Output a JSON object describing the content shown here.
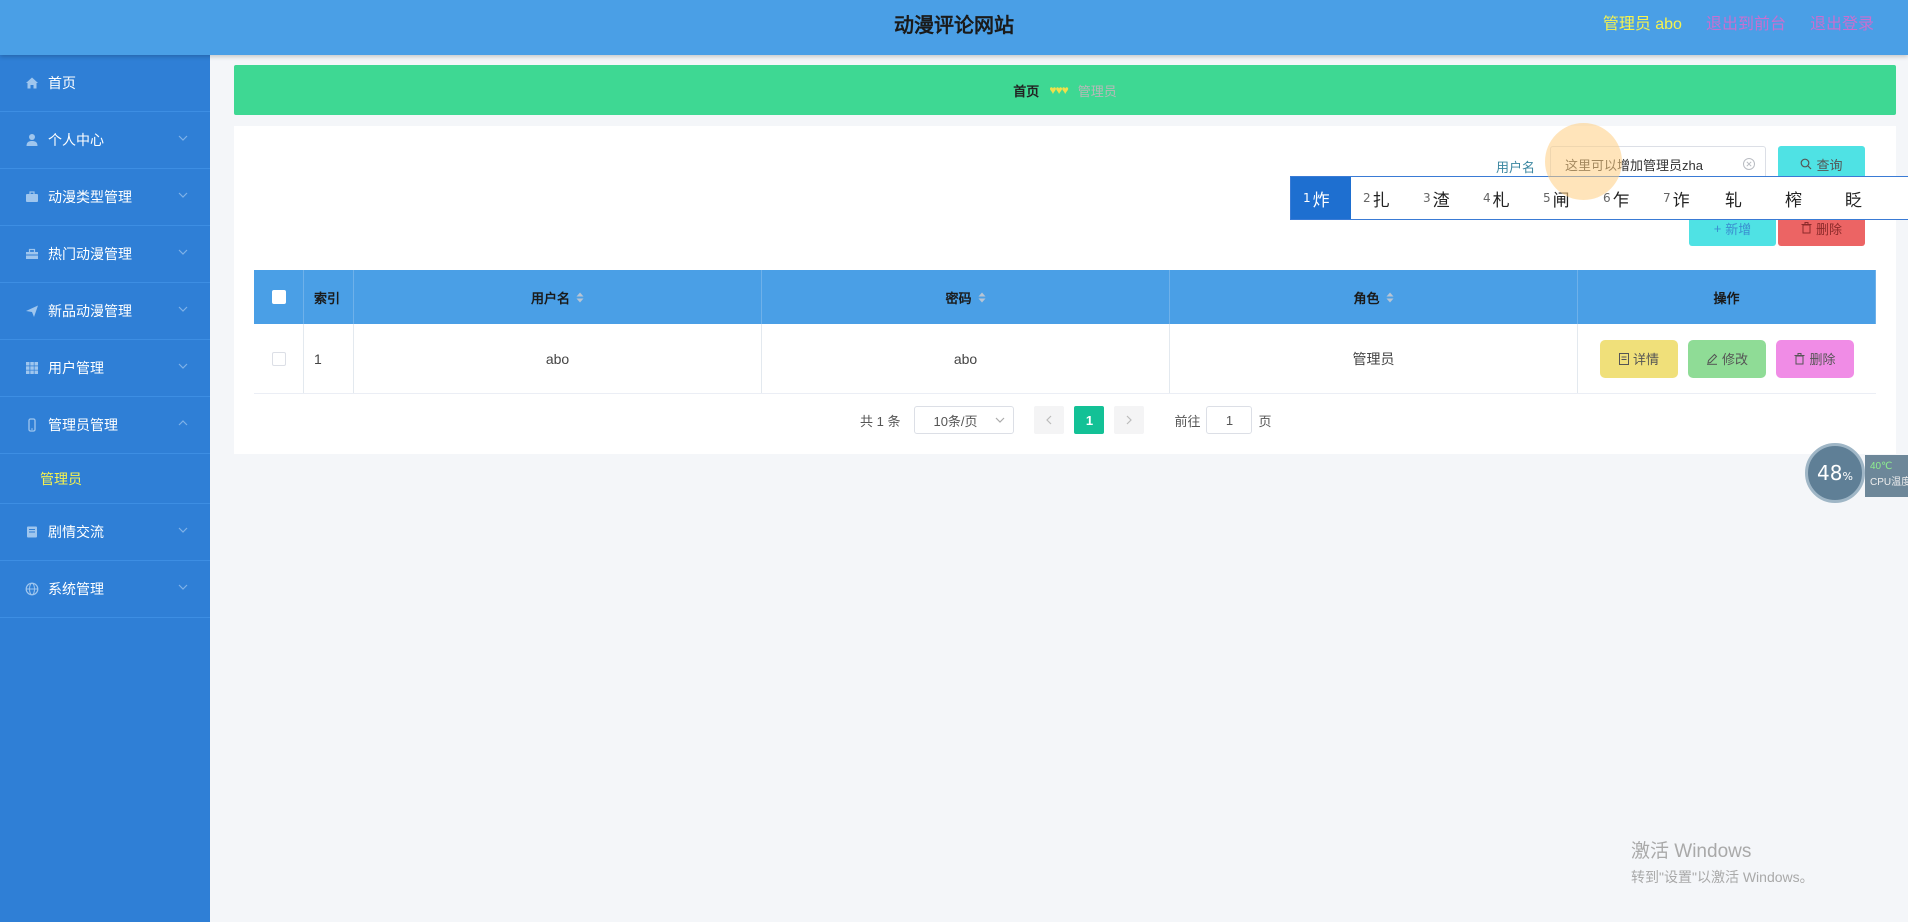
{
  "header": {
    "site_title": "动漫评论网站",
    "admin_label": "管理员 abo",
    "front_link": "退出到前台",
    "logout_link": "退出登录",
    "colors": {
      "bar": "#4a9fe6",
      "admin": "#f6f24e",
      "links": "#c86fd0"
    }
  },
  "sidebar": {
    "items": [
      {
        "label": "首页",
        "icon": "home-icon"
      },
      {
        "label": "个人中心",
        "icon": "user-icon"
      },
      {
        "label": "动漫类型管理",
        "icon": "briefcase-icon"
      },
      {
        "label": "热门动漫管理",
        "icon": "toolbox-icon"
      },
      {
        "label": "新品动漫管理",
        "icon": "send-icon"
      },
      {
        "label": "用户管理",
        "icon": "grid-icon"
      },
      {
        "label": "管理员管理",
        "icon": "phone-icon",
        "expanded": true
      },
      {
        "label": "剧情交流",
        "icon": "book-icon"
      },
      {
        "label": "系统管理",
        "icon": "globe-icon"
      }
    ],
    "sub_item": "管理员"
  },
  "breadcrumb": {
    "home": "首页",
    "separator": "♥♥♥",
    "current": "管理员"
  },
  "search": {
    "label": "用户名",
    "value": "这里可以增加管理员zha",
    "query_button": "查询"
  },
  "actions": {
    "add": "新增",
    "delete": "删除"
  },
  "ime": {
    "candidates": [
      {
        "num": "1",
        "char": "炸"
      },
      {
        "num": "2",
        "char": "扎"
      },
      {
        "num": "3",
        "char": "渣"
      },
      {
        "num": "4",
        "char": "札"
      },
      {
        "num": "5",
        "char": "闸"
      },
      {
        "num": "6",
        "char": "乍"
      },
      {
        "num": "7",
        "char": "诈"
      },
      {
        "num": "",
        "char": "轧"
      },
      {
        "num": "",
        "char": "榨"
      },
      {
        "num": "",
        "char": "眨"
      }
    ]
  },
  "table": {
    "headers": {
      "index": "索引",
      "username": "用户名",
      "password": "密码",
      "role": "角色",
      "ops": "操作"
    },
    "rows": [
      {
        "index": "1",
        "username": "abo",
        "password": "abo",
        "role": "管理员"
      }
    ],
    "op_buttons": {
      "detail": "详情",
      "edit": "修改",
      "delete": "删除"
    }
  },
  "pagination": {
    "total": "共 1 条",
    "page_size": "10条/页",
    "current_page": "1",
    "goto_label": "前往",
    "goto_value": "1",
    "page_suffix": "页"
  },
  "cpu_widget": {
    "percent": "48",
    "percent_sign": "%",
    "temp": "40℃",
    "label": "CPU温度"
  },
  "watermark": {
    "title": "激活 Windows",
    "subtitle": "转到\"设置\"以激活 Windows。"
  }
}
